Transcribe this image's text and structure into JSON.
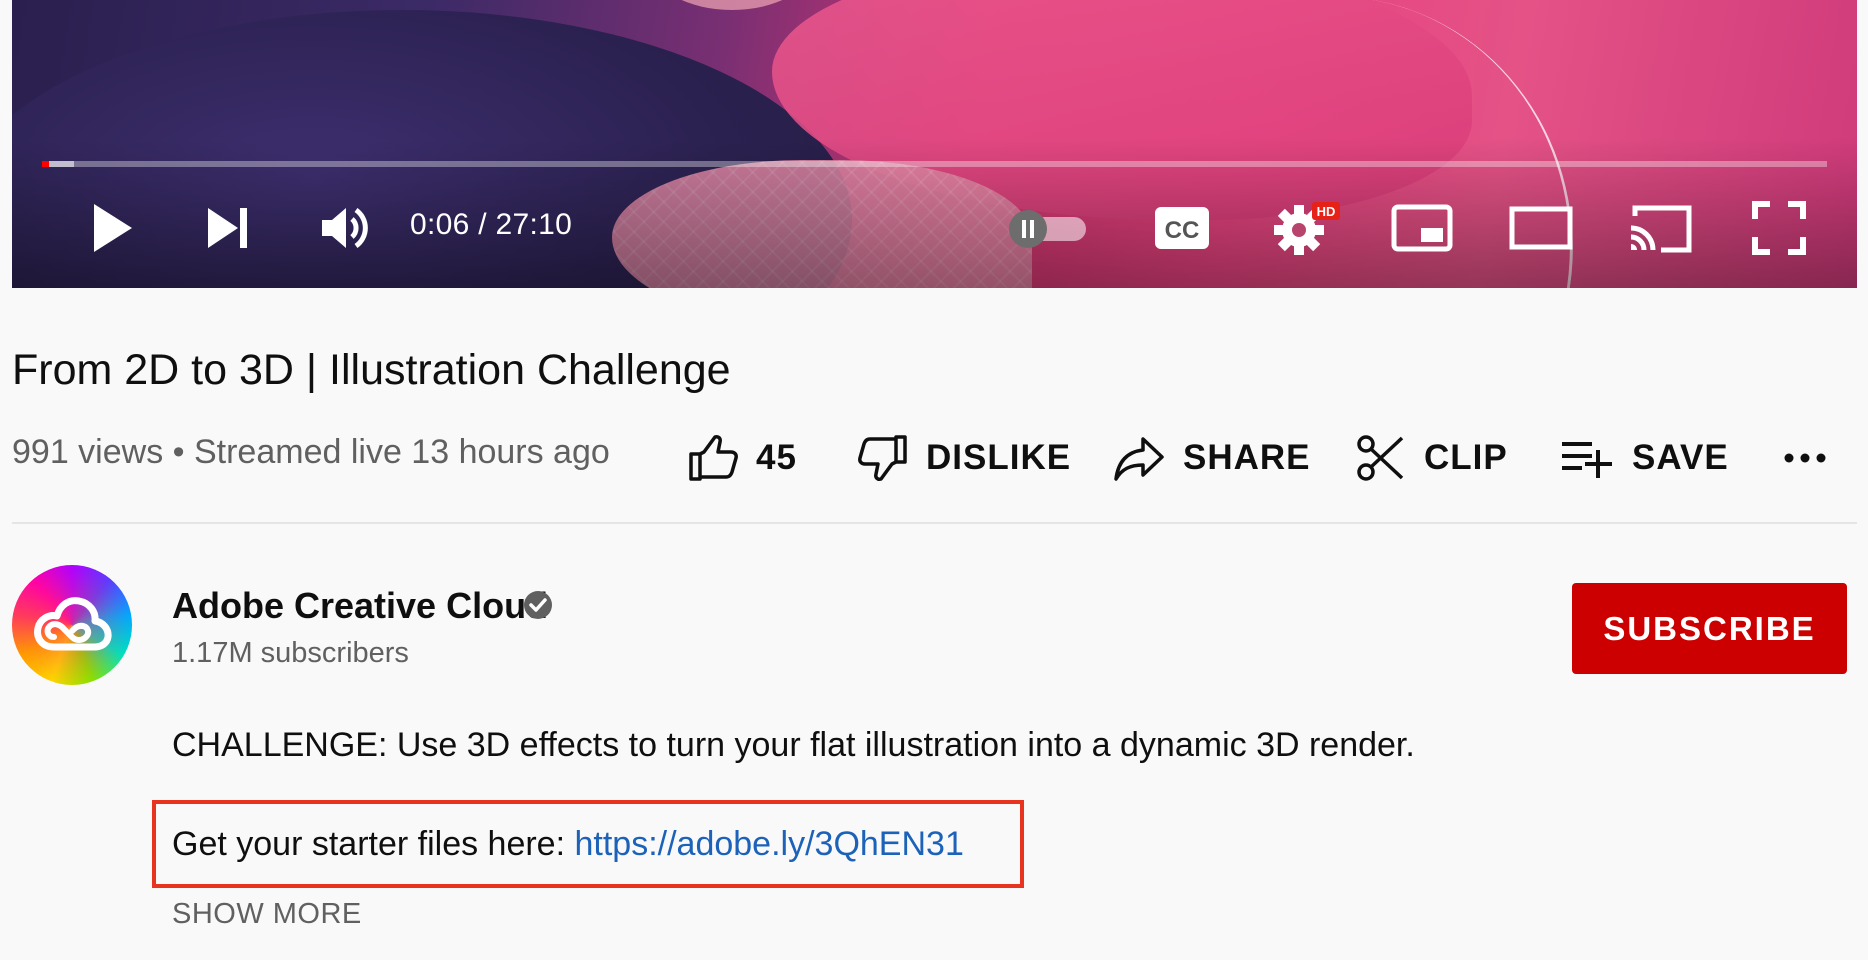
{
  "player": {
    "time_display": "0:06 / 27:10",
    "progress_fraction": 0.0037,
    "buffered_fraction": 0.018,
    "settings_badge": "HD",
    "captions_label": "CC"
  },
  "video": {
    "title": "From 2D to 3D | Illustration Challenge",
    "meta": "991 views • Streamed live 13 hours ago"
  },
  "actions": {
    "like_count": "45",
    "dislike_label": "DISLIKE",
    "share_label": "SHARE",
    "clip_label": "CLIP",
    "save_label": "SAVE",
    "more_label": "..."
  },
  "channel": {
    "name": "Adobe Creative Cloud",
    "subscribers": "1.17M subscribers",
    "subscribe_label": "SUBSCRIBE"
  },
  "description": {
    "line1": "CHALLENGE: Use 3D effects to turn your flat illustration into a dynamic 3D render.",
    "line2_prefix": "Get your starter files here: ",
    "link": "https://adobe.ly/3QhEN31",
    "show_more": "SHOW MORE"
  },
  "colors": {
    "subscribe_bg": "#cc0000",
    "link": "#1c62b9",
    "highlight_box": "#e8331f",
    "progress": "#ff0000"
  }
}
